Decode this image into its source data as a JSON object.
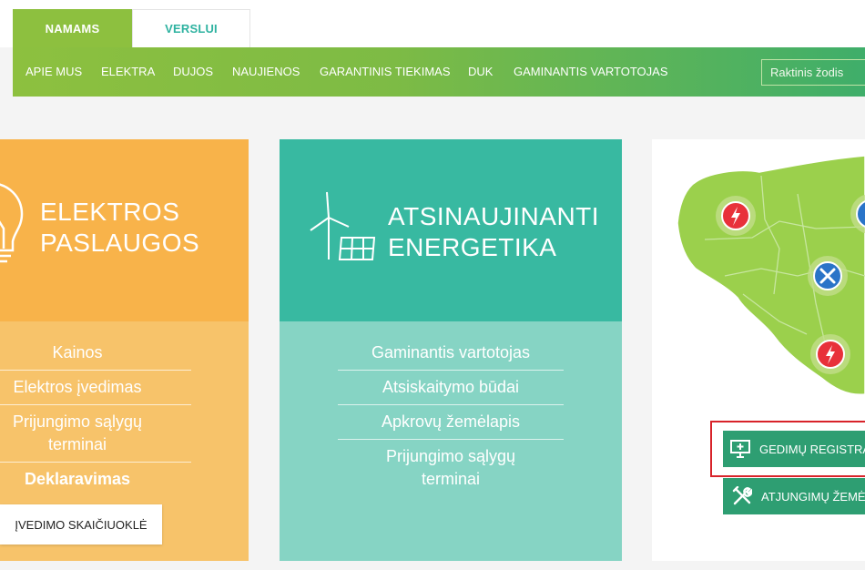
{
  "tabs": {
    "home": "NAMAMS",
    "business": "VERSLUI"
  },
  "nav": [
    "APIE MUS",
    "ELEKTRA",
    "DUJOS",
    "NAUJIENOS",
    "GARANTINIS TIEKIMAS",
    "DUK",
    "GAMINANTIS VARTOTOJAS"
  ],
  "search": {
    "placeholder": "Raktinis žodis"
  },
  "electricity": {
    "title_line1": "ELEKTROS",
    "title_line2": "PASLAUGOS",
    "links": [
      "Kainos",
      "Elektros įvedimas",
      "Prijungimo sąlygų terminai",
      "Deklaravimas"
    ],
    "calculator_button": "ĮVEDIMO SKAIČIUOKLĖ"
  },
  "renewable": {
    "title_line1": "ATSINAUJINANTI",
    "title_line2": "ENERGETIKA",
    "links": [
      "Gaminantis vartotojas",
      "Atsiskaitymo būdai",
      "Apkrovų žemėlapis",
      "Prijungimo sąlygų terminai"
    ]
  },
  "map": {
    "fault_button": "GEDIMŲ REGISTRACIJA",
    "outage_button": "ATJUNGIMŲ ŽEMĖLAPIS"
  },
  "colors": {
    "green": "#8dc03f",
    "teal": "#38b9a1",
    "orange": "#f8b34a",
    "map_green": "#9bd04c",
    "fault_red": "#e8313a",
    "service_blue": "#2a74c8",
    "highlight_red": "#d8232a"
  }
}
